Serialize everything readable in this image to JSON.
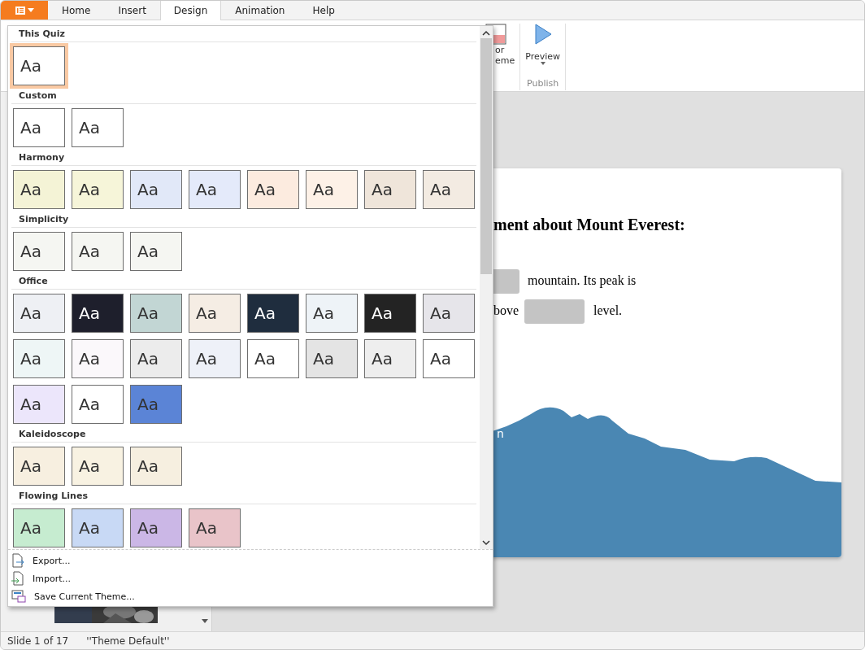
{
  "tabs": [
    {
      "label": "Home",
      "selected": false
    },
    {
      "label": "Insert",
      "selected": false
    },
    {
      "label": "Design",
      "selected": true
    },
    {
      "label": "Animation",
      "selected": false
    },
    {
      "label": "Help",
      "selected": false
    }
  ],
  "ribbon": {
    "color_theme_label": [
      "or",
      "eme"
    ],
    "preview_label": "Preview",
    "group_label": "Publish"
  },
  "theme_gallery": {
    "sections": [
      {
        "title": "This Quiz",
        "themes": [
          {
            "label": "Aa",
            "color": "#ffffff",
            "selected": true
          }
        ]
      },
      {
        "title": "Custom",
        "themes": [
          {
            "label": "Aa",
            "color": "#ffffff",
            "selected": false
          },
          {
            "label": "Aa",
            "color": "#ffffff",
            "selected": false
          }
        ]
      },
      {
        "title": "Harmony",
        "themes": [
          {
            "label": "Aa",
            "color": "#f4f3d6",
            "selected": false
          },
          {
            "label": "Aa",
            "color": "#f6f5d9",
            "selected": false
          },
          {
            "label": "Aa",
            "color": "#e1e8f8",
            "selected": false
          },
          {
            "label": "Aa",
            "color": "#e4eafa",
            "selected": false
          },
          {
            "label": "Aa",
            "color": "#fcebdf",
            "selected": false
          },
          {
            "label": "Aa",
            "color": "#fdf1e7",
            "selected": false
          },
          {
            "label": "Aa",
            "color": "#efe5da",
            "selected": false
          },
          {
            "label": "Aa",
            "color": "#f3ebe2",
            "selected": false
          }
        ]
      },
      {
        "title": "Simplicity",
        "themes": [
          {
            "label": "Aa",
            "color": "#f5f6f2",
            "selected": false
          },
          {
            "label": "Aa",
            "color": "#f5f6f2",
            "selected": false
          },
          {
            "label": "Aa",
            "color": "#f5f6f2",
            "selected": false
          }
        ]
      },
      {
        "title": "Office",
        "themes": [
          {
            "label": "Aa",
            "color": "#eef0f4",
            "selected": false
          },
          {
            "label": "Aa",
            "color": "#1e1f2c",
            "selected": false
          },
          {
            "label": "Aa",
            "color": "#c2d6d4",
            "selected": false
          },
          {
            "label": "Aa",
            "color": "#f5ede4",
            "selected": false
          },
          {
            "label": "Aa",
            "color": "#1f2d3e",
            "selected": false
          },
          {
            "label": "Aa",
            "color": "#eef3f7",
            "selected": false
          },
          {
            "label": "Aa",
            "color": "#232323",
            "selected": false
          },
          {
            "label": "Aa",
            "color": "#e6e5ea",
            "selected": false
          },
          {
            "label": "Aa",
            "color": "#eef6f6",
            "selected": false
          },
          {
            "label": "Aa",
            "color": "#fbf8fb",
            "selected": false
          },
          {
            "label": "Aa",
            "color": "#ececec",
            "selected": false
          },
          {
            "label": "Aa",
            "color": "#eef1f8",
            "selected": false
          },
          {
            "label": "Aa",
            "color": "#ffffff",
            "selected": false
          },
          {
            "label": "Aa",
            "color": "#e4e4e4",
            "selected": false
          },
          {
            "label": "Aa",
            "color": "#eeeeee",
            "selected": false
          },
          {
            "label": "Aa",
            "color": "#ffffff",
            "selected": false
          },
          {
            "label": "Aa",
            "color": "#ece6fb",
            "selected": false
          },
          {
            "label": "Aa",
            "color": "#ffffff",
            "selected": false
          },
          {
            "label": "Aa",
            "color": "#5b84d6",
            "selected": false
          }
        ]
      },
      {
        "title": "Kaleidoscope",
        "themes": [
          {
            "label": "Aa",
            "color": "#f7efe0",
            "selected": false
          },
          {
            "label": "Aa",
            "color": "#f8f2e2",
            "selected": false
          },
          {
            "label": "Aa",
            "color": "#f6efe0",
            "selected": false
          }
        ]
      },
      {
        "title": "Flowing Lines",
        "themes": [
          {
            "label": "Aa",
            "color": "#c6ecd0",
            "selected": false
          },
          {
            "label": "Aa",
            "color": "#c8d9f5",
            "selected": false
          },
          {
            "label": "Aa",
            "color": "#cbb7e6",
            "selected": false
          },
          {
            "label": "Aa",
            "color": "#e9c4c9",
            "selected": false
          }
        ]
      }
    ],
    "actions": [
      {
        "kind": "export",
        "label": "Export..."
      },
      {
        "kind": "import",
        "label": "Import..."
      },
      {
        "kind": "save",
        "label": "Save Current Theme..."
      }
    ]
  },
  "slide": {
    "title": "ment about Mount Everest:",
    "line_1": "mountain. Its peak is",
    "line_2_start": "bove",
    "line_2_end": "level.",
    "caption": "n"
  },
  "status_bar": {
    "slide": "Slide 1 of 17",
    "theme": "''Theme Default''"
  }
}
